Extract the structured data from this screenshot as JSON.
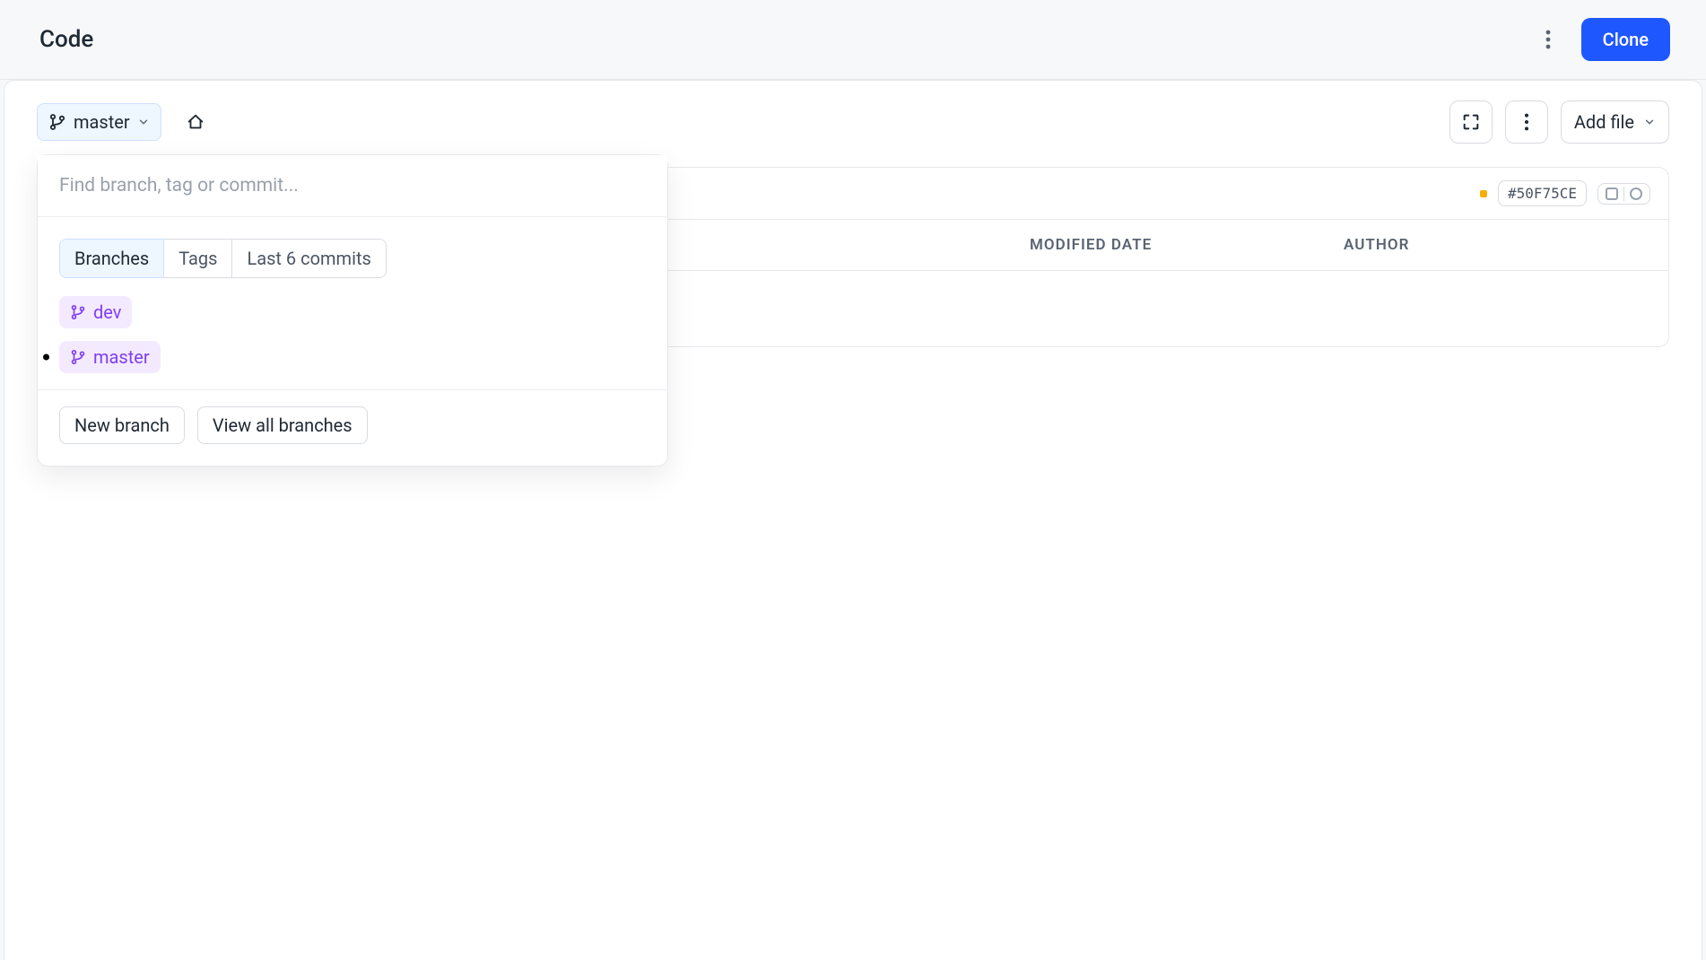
{
  "header": {
    "title": "Code",
    "clone_label": "Clone"
  },
  "toolbar": {
    "branch_label": "master",
    "add_file_label": "Add file"
  },
  "file_panel": {
    "commit_hash": "#50F75CE",
    "columns": {
      "name": "",
      "modified": "MODIFIED DATE",
      "author": "AUTHOR"
    }
  },
  "dropdown": {
    "search_placeholder": "Find branch, tag or commit...",
    "segments": {
      "branches": "Branches",
      "tags": "Tags",
      "last_commits": "Last 6 commits"
    },
    "branches": [
      {
        "name": "dev",
        "current": false
      },
      {
        "name": "master",
        "current": true
      }
    ],
    "footer": {
      "new_branch": "New branch",
      "view_all": "View all branches"
    }
  }
}
